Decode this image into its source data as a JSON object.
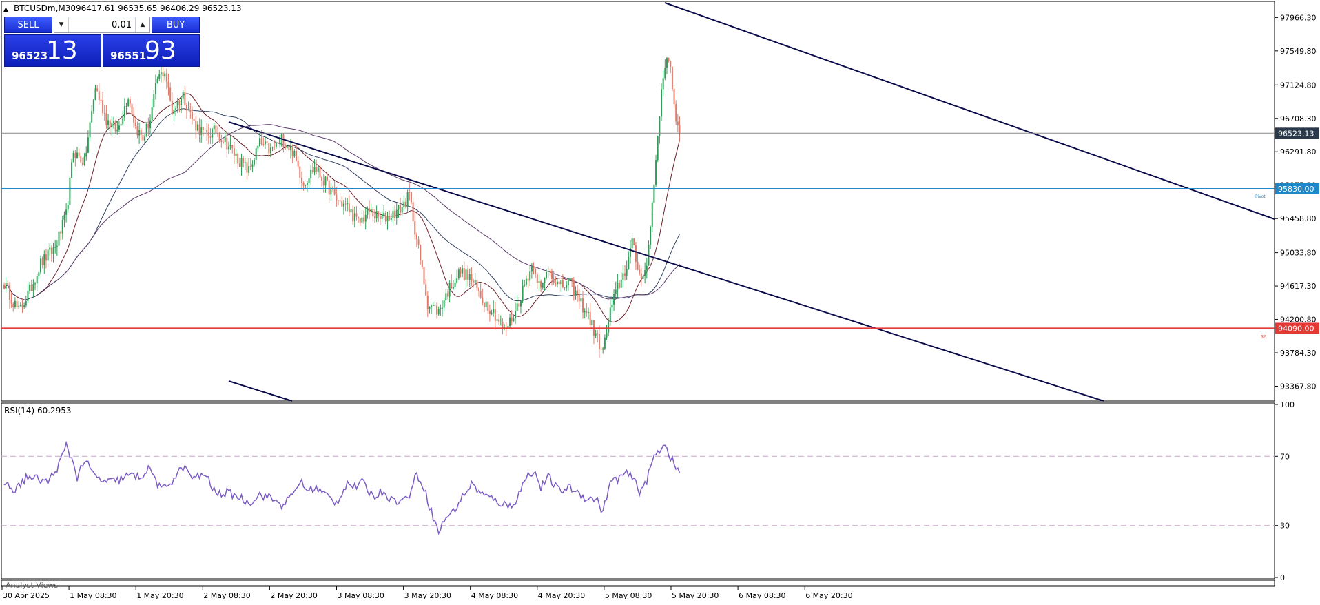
{
  "header": {
    "title": "BTCUSDm,M30",
    "ohlc": "96417.61 96535.65 96406.29 96523.13"
  },
  "trade_panel": {
    "sell_label": "SELL",
    "buy_label": "BUY",
    "lot_value": "0.01",
    "sell_price_main": "96523",
    "sell_price_pips": "13",
    "buy_price_main": "96551",
    "buy_price_pips": "93"
  },
  "colors": {
    "bull_candle": "#2e9e56",
    "bear_candle": "#e07a6a",
    "trendline": "#0a0a4a",
    "pivot_line": "#1e88c8",
    "s2_line": "#e53935",
    "current_price_box": "#2a3a4a",
    "rsi_line": "#7b5cc4"
  },
  "price_axis": {
    "ticks": [
      "97966.30",
      "97549.80",
      "97124.80",
      "96708.30",
      "96291.80",
      "95875.30",
      "95458.80",
      "95033.80",
      "94617.30",
      "94200.80",
      "93784.30",
      "93367.80"
    ]
  },
  "levels": {
    "current_price": "96523.13",
    "pivot_price": "95830.00",
    "pivot_tag": "Pivot",
    "s2_price": "94090.00",
    "s2_tag": "S2"
  },
  "rsi": {
    "label": "RSI(14) 60.2953",
    "ticks": [
      "100",
      "70",
      "30",
      "0"
    ]
  },
  "bottom_panel": {
    "label": "Analyst Views"
  },
  "time_axis": {
    "labels": [
      "30 Apr 2025",
      "1 May 08:30",
      "1 May 20:30",
      "2 May 08:30",
      "2 May 20:30",
      "3 May 08:30",
      "3 May 20:30",
      "4 May 08:30",
      "4 May 20:30",
      "5 May 08:30",
      "5 May 20:30",
      "6 May 08:30",
      "6 May 20:30"
    ]
  },
  "chart_data": {
    "type": "candlestick",
    "symbol": "BTCUSDm",
    "timeframe": "M30",
    "keypoints": [
      {
        "t": 0,
        "p": 94650
      },
      {
        "t": 8,
        "p": 94300
      },
      {
        "t": 14,
        "p": 94550
      },
      {
        "t": 20,
        "p": 94900
      },
      {
        "t": 28,
        "p": 95100
      },
      {
        "t": 34,
        "p": 95500
      },
      {
        "t": 38,
        "p": 96300
      },
      {
        "t": 44,
        "p": 96150
      },
      {
        "t": 50,
        "p": 97100
      },
      {
        "t": 56,
        "p": 96700
      },
      {
        "t": 62,
        "p": 96550
      },
      {
        "t": 68,
        "p": 97000
      },
      {
        "t": 72,
        "p": 96600
      },
      {
        "t": 76,
        "p": 96450
      },
      {
        "t": 80,
        "p": 96700
      },
      {
        "t": 84,
        "p": 97200
      },
      {
        "t": 88,
        "p": 97300
      },
      {
        "t": 92,
        "p": 96800
      },
      {
        "t": 98,
        "p": 97000
      },
      {
        "t": 104,
        "p": 96650
      },
      {
        "t": 110,
        "p": 96500
      },
      {
        "t": 116,
        "p": 96550
      },
      {
        "t": 122,
        "p": 96400
      },
      {
        "t": 128,
        "p": 96200
      },
      {
        "t": 134,
        "p": 96050
      },
      {
        "t": 140,
        "p": 96400
      },
      {
        "t": 146,
        "p": 96300
      },
      {
        "t": 152,
        "p": 96450
      },
      {
        "t": 158,
        "p": 96300
      },
      {
        "t": 164,
        "p": 95900
      },
      {
        "t": 170,
        "p": 96100
      },
      {
        "t": 176,
        "p": 95900
      },
      {
        "t": 182,
        "p": 95700
      },
      {
        "t": 188,
        "p": 95600
      },
      {
        "t": 194,
        "p": 95400
      },
      {
        "t": 200,
        "p": 95550
      },
      {
        "t": 206,
        "p": 95450
      },
      {
        "t": 212,
        "p": 95500
      },
      {
        "t": 218,
        "p": 95600
      },
      {
        "t": 222,
        "p": 95750
      },
      {
        "t": 226,
        "p": 95200
      },
      {
        "t": 232,
        "p": 94400
      },
      {
        "t": 238,
        "p": 94300
      },
      {
        "t": 244,
        "p": 94600
      },
      {
        "t": 250,
        "p": 94800
      },
      {
        "t": 256,
        "p": 94700
      },
      {
        "t": 262,
        "p": 94450
      },
      {
        "t": 268,
        "p": 94300
      },
      {
        "t": 274,
        "p": 94050
      },
      {
        "t": 280,
        "p": 94300
      },
      {
        "t": 286,
        "p": 94700
      },
      {
        "t": 290,
        "p": 94900
      },
      {
        "t": 294,
        "p": 94550
      },
      {
        "t": 298,
        "p": 94850
      },
      {
        "t": 304,
        "p": 94600
      },
      {
        "t": 310,
        "p": 94650
      },
      {
        "t": 316,
        "p": 94400
      },
      {
        "t": 320,
        "p": 94250
      },
      {
        "t": 324,
        "p": 94000
      },
      {
        "t": 328,
        "p": 93800
      },
      {
        "t": 332,
        "p": 94300
      },
      {
        "t": 336,
        "p": 94600
      },
      {
        "t": 340,
        "p": 94800
      },
      {
        "t": 344,
        "p": 95150
      },
      {
        "t": 348,
        "p": 94750
      },
      {
        "t": 352,
        "p": 94850
      },
      {
        "t": 356,
        "p": 95900
      },
      {
        "t": 359,
        "p": 96800
      },
      {
        "t": 362,
        "p": 97400
      },
      {
        "t": 364,
        "p": 97500
      },
      {
        "t": 366,
        "p": 97100
      },
      {
        "t": 368,
        "p": 96600
      },
      {
        "t": 370,
        "p": 96523
      }
    ],
    "rsi_keypoints": [
      {
        "t": 0,
        "v": 55
      },
      {
        "t": 6,
        "v": 50
      },
      {
        "t": 12,
        "v": 58
      },
      {
        "t": 18,
        "v": 57
      },
      {
        "t": 24,
        "v": 55
      },
      {
        "t": 30,
        "v": 65
      },
      {
        "t": 34,
        "v": 76
      },
      {
        "t": 38,
        "v": 66
      },
      {
        "t": 40,
        "v": 58
      },
      {
        "t": 44,
        "v": 68
      },
      {
        "t": 50,
        "v": 58
      },
      {
        "t": 56,
        "v": 55
      },
      {
        "t": 62,
        "v": 56
      },
      {
        "t": 68,
        "v": 59
      },
      {
        "t": 74,
        "v": 58
      },
      {
        "t": 80,
        "v": 63
      },
      {
        "t": 86,
        "v": 50
      },
      {
        "t": 92,
        "v": 56
      },
      {
        "t": 98,
        "v": 64
      },
      {
        "t": 104,
        "v": 57
      },
      {
        "t": 110,
        "v": 60
      },
      {
        "t": 116,
        "v": 48
      },
      {
        "t": 122,
        "v": 49
      },
      {
        "t": 128,
        "v": 47
      },
      {
        "t": 134,
        "v": 43
      },
      {
        "t": 140,
        "v": 48
      },
      {
        "t": 146,
        "v": 46
      },
      {
        "t": 152,
        "v": 42
      },
      {
        "t": 158,
        "v": 47
      },
      {
        "t": 162,
        "v": 56
      },
      {
        "t": 166,
        "v": 50
      },
      {
        "t": 170,
        "v": 52
      },
      {
        "t": 176,
        "v": 48
      },
      {
        "t": 182,
        "v": 43
      },
      {
        "t": 188,
        "v": 55
      },
      {
        "t": 192,
        "v": 52
      },
      {
        "t": 196,
        "v": 55
      },
      {
        "t": 202,
        "v": 47
      },
      {
        "t": 208,
        "v": 50
      },
      {
        "t": 212,
        "v": 45
      },
      {
        "t": 218,
        "v": 44
      },
      {
        "t": 222,
        "v": 48
      },
      {
        "t": 226,
        "v": 60
      },
      {
        "t": 230,
        "v": 52
      },
      {
        "t": 234,
        "v": 38
      },
      {
        "t": 238,
        "v": 26
      },
      {
        "t": 242,
        "v": 35
      },
      {
        "t": 246,
        "v": 38
      },
      {
        "t": 250,
        "v": 45
      },
      {
        "t": 256,
        "v": 54
      },
      {
        "t": 262,
        "v": 48
      },
      {
        "t": 268,
        "v": 45
      },
      {
        "t": 272,
        "v": 43
      },
      {
        "t": 276,
        "v": 41
      },
      {
        "t": 280,
        "v": 44
      },
      {
        "t": 286,
        "v": 58
      },
      {
        "t": 290,
        "v": 62
      },
      {
        "t": 294,
        "v": 52
      },
      {
        "t": 298,
        "v": 58
      },
      {
        "t": 304,
        "v": 50
      },
      {
        "t": 310,
        "v": 52
      },
      {
        "t": 316,
        "v": 48
      },
      {
        "t": 320,
        "v": 45
      },
      {
        "t": 324,
        "v": 46
      },
      {
        "t": 328,
        "v": 38
      },
      {
        "t": 332,
        "v": 55
      },
      {
        "t": 336,
        "v": 57
      },
      {
        "t": 340,
        "v": 60
      },
      {
        "t": 344,
        "v": 58
      },
      {
        "t": 348,
        "v": 50
      },
      {
        "t": 352,
        "v": 56
      },
      {
        "t": 356,
        "v": 70
      },
      {
        "t": 360,
        "v": 75
      },
      {
        "t": 362,
        "v": 78
      },
      {
        "t": 364,
        "v": 72
      },
      {
        "t": 368,
        "v": 63
      },
      {
        "t": 370,
        "v": 60.3
      }
    ],
    "ylim": [
      93200,
      98150
    ],
    "rsi_ylim": [
      0,
      100
    ],
    "rsi_levels": [
      70,
      30
    ],
    "bars_visible": 371,
    "grid": false
  }
}
